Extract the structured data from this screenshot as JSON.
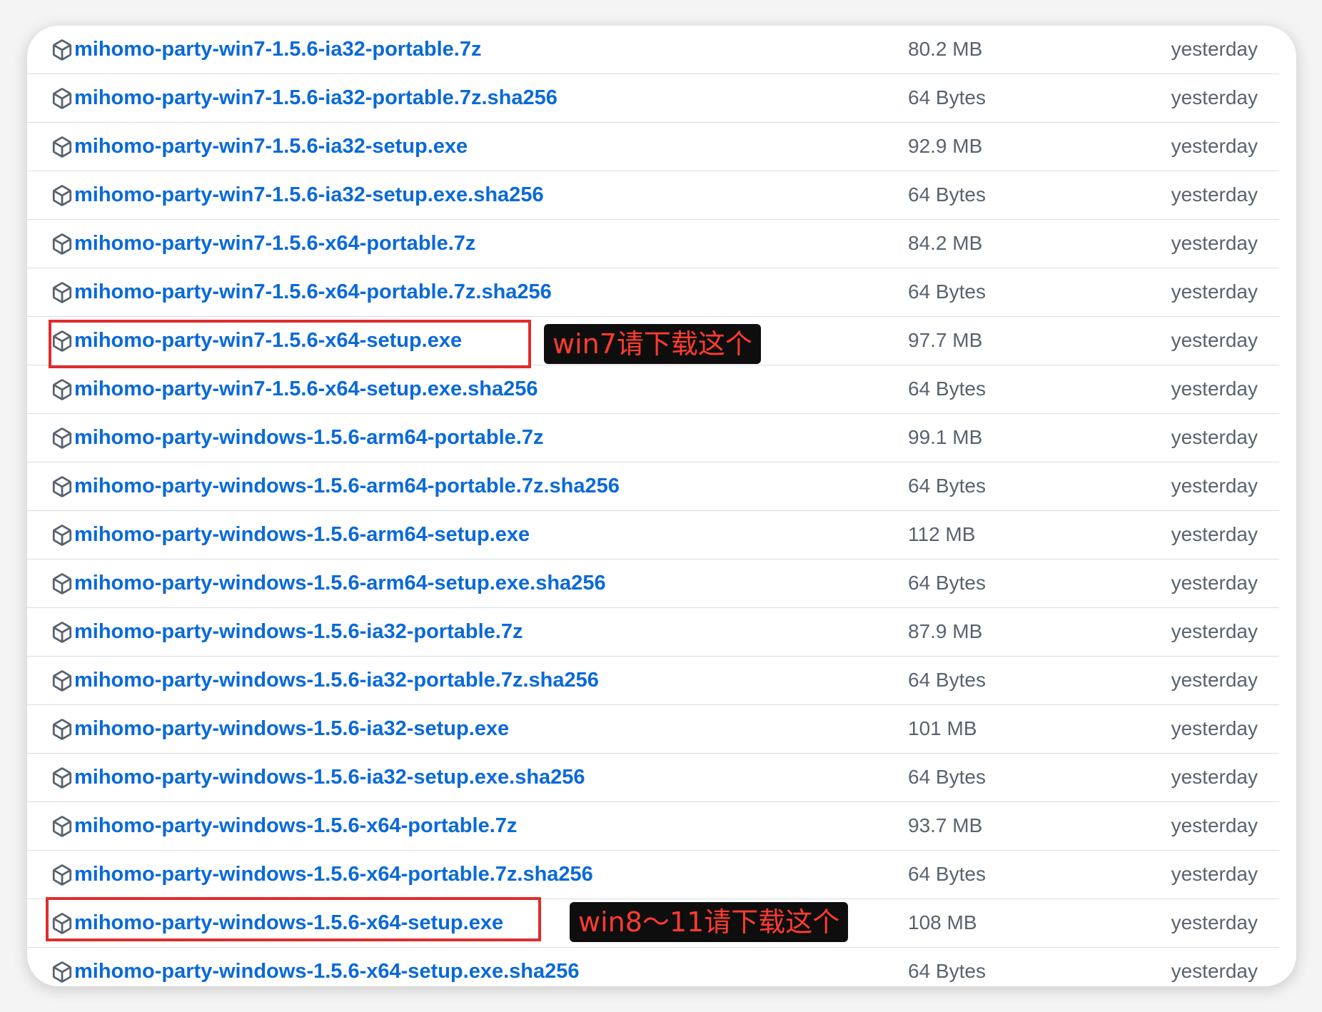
{
  "colors": {
    "link": "#0969da",
    "muted": "#59636e",
    "annotation_border": "#e02c2c",
    "annotation_text": "#ff3b2f"
  },
  "assets": [
    {
      "name": "mihomo-party-win7-1.5.6-ia32-portable.7z",
      "size": "80.2 MB",
      "date": "yesterday"
    },
    {
      "name": "mihomo-party-win7-1.5.6-ia32-portable.7z.sha256",
      "size": "64 Bytes",
      "date": "yesterday"
    },
    {
      "name": "mihomo-party-win7-1.5.6-ia32-setup.exe",
      "size": "92.9 MB",
      "date": "yesterday"
    },
    {
      "name": "mihomo-party-win7-1.5.6-ia32-setup.exe.sha256",
      "size": "64 Bytes",
      "date": "yesterday"
    },
    {
      "name": "mihomo-party-win7-1.5.6-x64-portable.7z",
      "size": "84.2 MB",
      "date": "yesterday"
    },
    {
      "name": "mihomo-party-win7-1.5.6-x64-portable.7z.sha256",
      "size": "64 Bytes",
      "date": "yesterday"
    },
    {
      "name": "mihomo-party-win7-1.5.6-x64-setup.exe",
      "size": "97.7 MB",
      "date": "yesterday"
    },
    {
      "name": "mihomo-party-win7-1.5.6-x64-setup.exe.sha256",
      "size": "64 Bytes",
      "date": "yesterday"
    },
    {
      "name": "mihomo-party-windows-1.5.6-arm64-portable.7z",
      "size": "99.1 MB",
      "date": "yesterday"
    },
    {
      "name": "mihomo-party-windows-1.5.6-arm64-portable.7z.sha256",
      "size": "64 Bytes",
      "date": "yesterday"
    },
    {
      "name": "mihomo-party-windows-1.5.6-arm64-setup.exe",
      "size": "112 MB",
      "date": "yesterday"
    },
    {
      "name": "mihomo-party-windows-1.5.6-arm64-setup.exe.sha256",
      "size": "64 Bytes",
      "date": "yesterday"
    },
    {
      "name": "mihomo-party-windows-1.5.6-ia32-portable.7z",
      "size": "87.9 MB",
      "date": "yesterday"
    },
    {
      "name": "mihomo-party-windows-1.5.6-ia32-portable.7z.sha256",
      "size": "64 Bytes",
      "date": "yesterday"
    },
    {
      "name": "mihomo-party-windows-1.5.6-ia32-setup.exe",
      "size": "101 MB",
      "date": "yesterday"
    },
    {
      "name": "mihomo-party-windows-1.5.6-ia32-setup.exe.sha256",
      "size": "64 Bytes",
      "date": "yesterday"
    },
    {
      "name": "mihomo-party-windows-1.5.6-x64-portable.7z",
      "size": "93.7 MB",
      "date": "yesterday"
    },
    {
      "name": "mihomo-party-windows-1.5.6-x64-portable.7z.sha256",
      "size": "64 Bytes",
      "date": "yesterday"
    },
    {
      "name": "mihomo-party-windows-1.5.6-x64-setup.exe",
      "size": "108 MB",
      "date": "yesterday"
    },
    {
      "name": "mihomo-party-windows-1.5.6-x64-setup.exe.sha256",
      "size": "64 Bytes",
      "date": "yesterday"
    }
  ],
  "annotations": [
    {
      "row_index": 6,
      "text": "win7请下载这个"
    },
    {
      "row_index": 18,
      "text": "win8～11请下载这个"
    }
  ]
}
